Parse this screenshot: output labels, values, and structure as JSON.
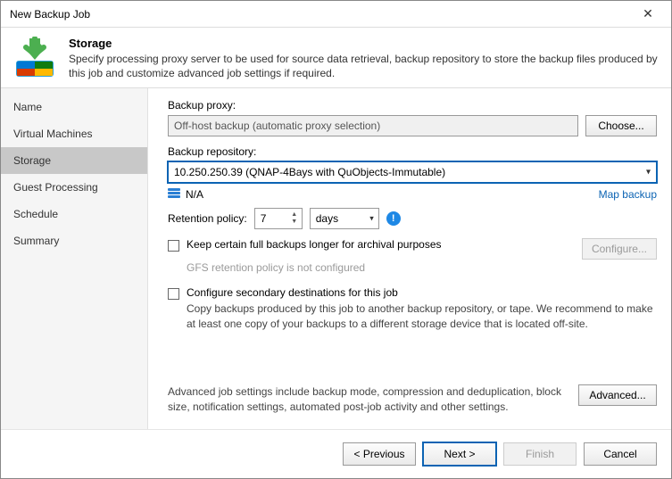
{
  "window": {
    "title": "New Backup Job"
  },
  "header": {
    "title": "Storage",
    "desc": "Specify processing proxy server to be used for source data retrieval, backup repository to store the backup files produced by this job and customize advanced job settings if required."
  },
  "sidebar": {
    "items": [
      {
        "label": "Name"
      },
      {
        "label": "Virtual Machines"
      },
      {
        "label": "Storage"
      },
      {
        "label": "Guest Processing"
      },
      {
        "label": "Schedule"
      },
      {
        "label": "Summary"
      }
    ],
    "active_index": 2
  },
  "proxy": {
    "label": "Backup proxy:",
    "value": "Off-host backup (automatic proxy selection)",
    "choose_btn": "Choose..."
  },
  "repo": {
    "label": "Backup repository:",
    "value": "10.250.250.39 (QNAP-4Bays with QuObjects-Immutable)",
    "capacity": "N/A",
    "map_link": "Map backup"
  },
  "retention": {
    "label": "Retention policy:",
    "value": "7",
    "unit": "days"
  },
  "keep_full": {
    "label": "Keep certain full backups longer for archival purposes",
    "note": "GFS retention policy is not configured",
    "configure_btn": "Configure..."
  },
  "secondary": {
    "label": "Configure secondary destinations for this job",
    "desc": "Copy backups produced by this job to another backup repository, or tape. We recommend to make at least one copy of your backups to a different storage device that is located off-site."
  },
  "advanced": {
    "desc": "Advanced job settings include backup mode, compression and deduplication, block size, notification settings, automated post-job activity and other settings.",
    "btn": "Advanced..."
  },
  "nav": {
    "previous": "< Previous",
    "next": "Next >",
    "finish": "Finish",
    "cancel": "Cancel"
  }
}
